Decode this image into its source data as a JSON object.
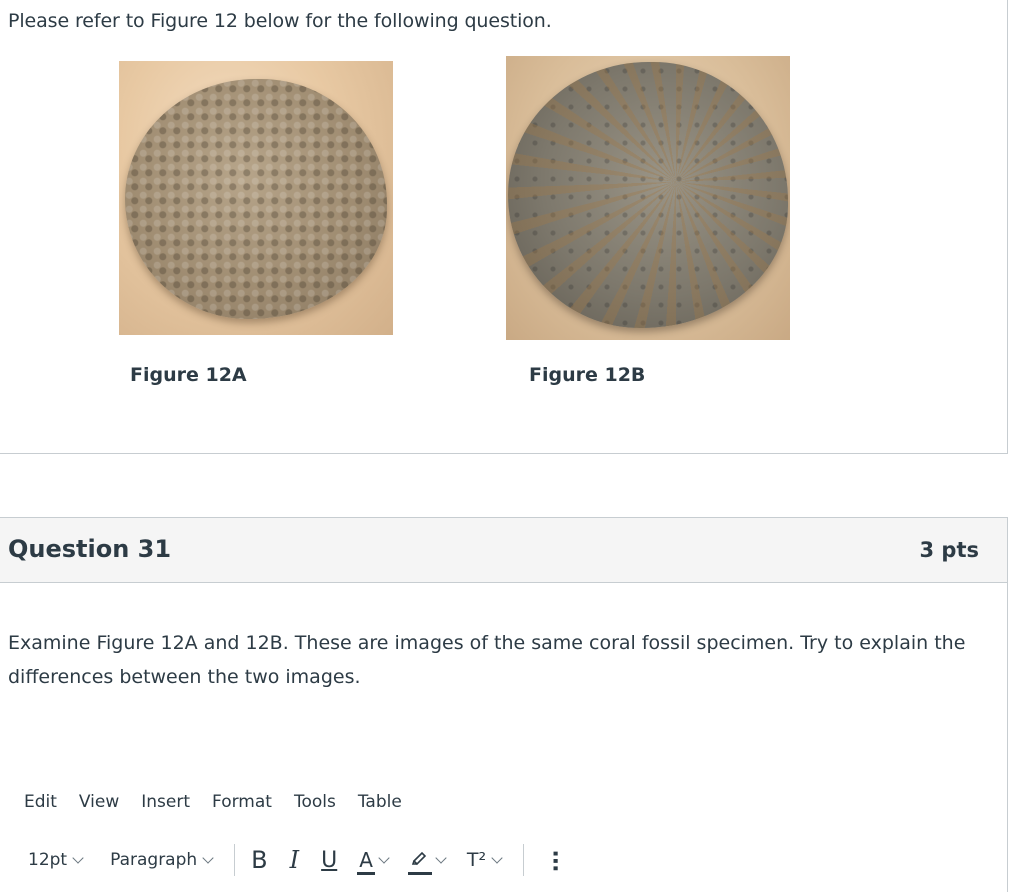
{
  "stimulus": {
    "prompt": "Please refer to Figure 12 below for the following question.",
    "figures": [
      {
        "caption": "Figure 12A"
      },
      {
        "caption": "Figure 12B"
      }
    ]
  },
  "question": {
    "title": "Question 31",
    "points": "3 pts",
    "text": "Examine Figure 12A and 12B. These are images of the same coral fossil specimen. Try to explain the differences between the two images."
  },
  "editor": {
    "menu": [
      "Edit",
      "View",
      "Insert",
      "Format",
      "Tools",
      "Table"
    ],
    "font_size": "12pt",
    "block_format": "Paragraph",
    "bold": "B",
    "italic": "I",
    "underline": "U",
    "text_color": "A",
    "superscript": "T²",
    "more": "⋯"
  },
  "colors": {
    "border": "#c7cdd1",
    "header_bg": "#f5f5f5",
    "text": "#2d3b45"
  }
}
